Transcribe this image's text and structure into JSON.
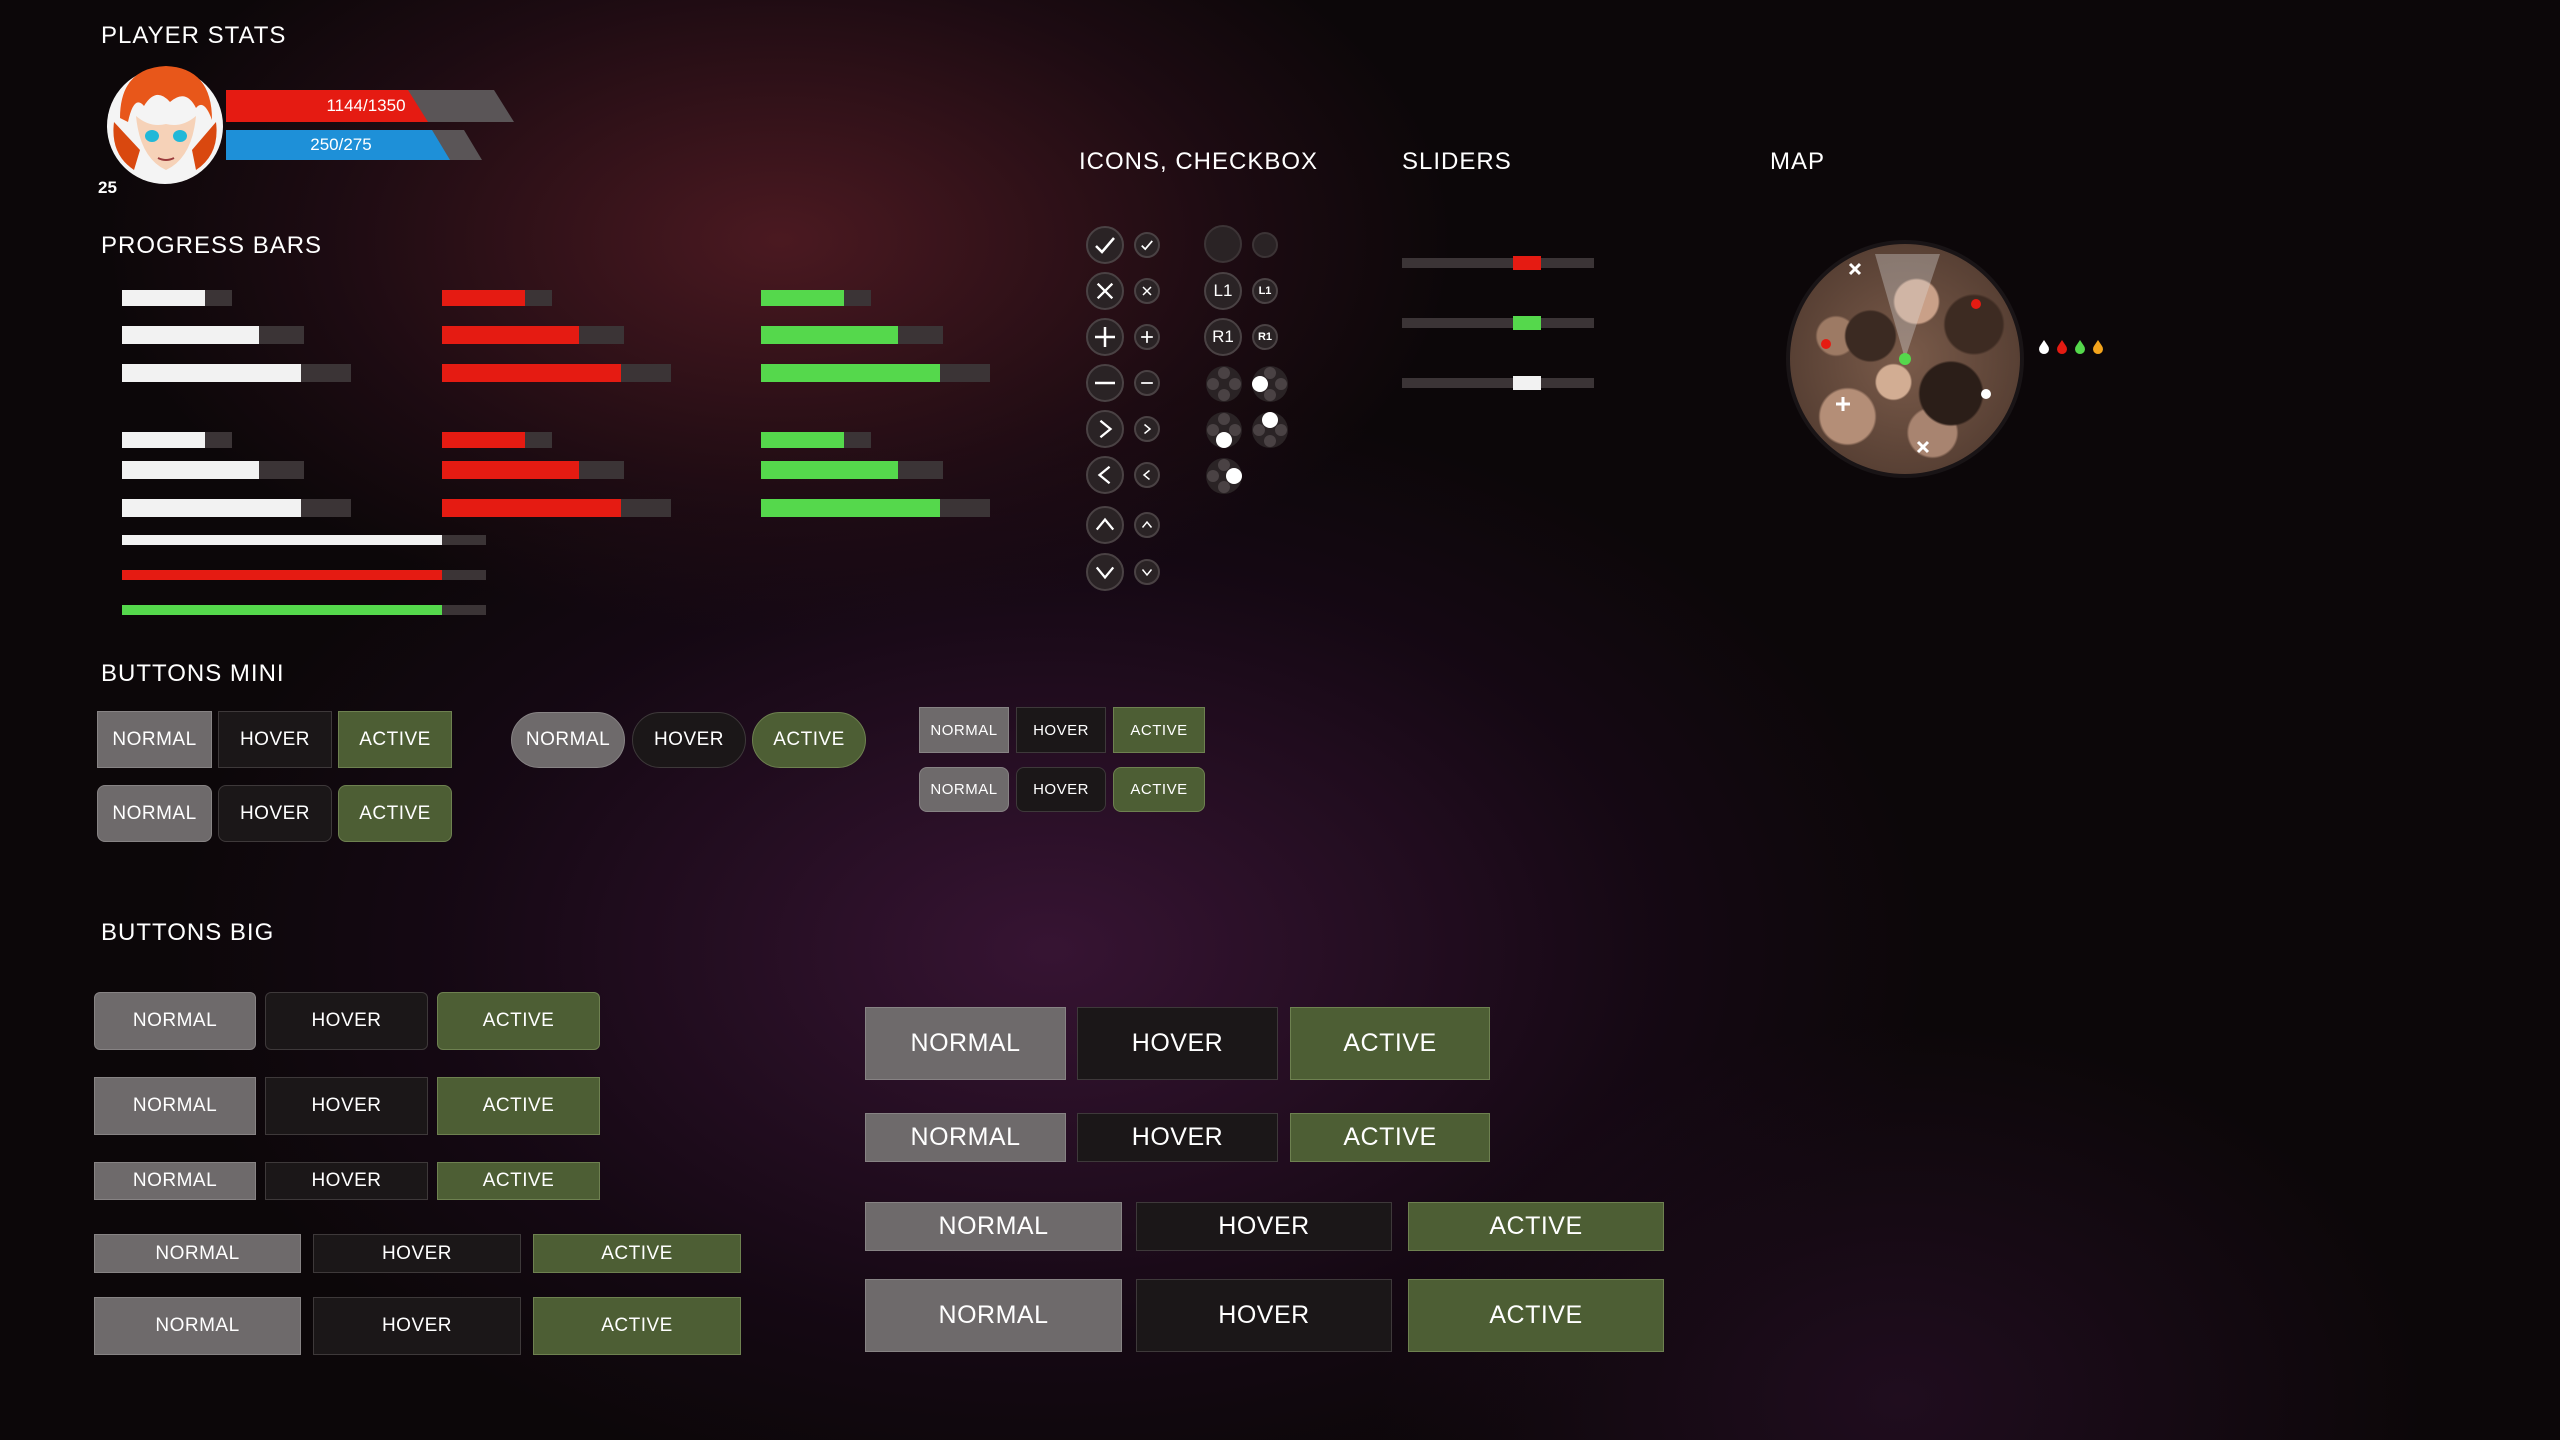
{
  "sections": {
    "player_stats": "PLAYER STATS",
    "progress_bars": "PROGRESS BARS",
    "icons_checkbox": "ICONS, CHECKBOX",
    "sliders": "SLIDERS",
    "map": "MAP",
    "buttons_mini": "BUTTONS MINI",
    "buttons_big": "BUTTONS BIG"
  },
  "player": {
    "health_text": "1144/1350",
    "health_fraction": 0.847,
    "mana_text": "250/275",
    "mana_fraction": 0.909,
    "level": "25"
  },
  "progress": {
    "groups_fill_fractions": [
      0.75,
      0.75,
      0.78
    ],
    "long_bar_fill_fraction": 0.88
  },
  "sliders": {
    "values": [
      0.65,
      0.65,
      0.65
    ],
    "colors": [
      "#e51b12",
      "#55d84c",
      "#f2f2f2"
    ]
  },
  "icons": {
    "controller_labels": [
      "L1",
      "R1"
    ],
    "glyphs": [
      "check-icon",
      "close-icon",
      "plus-icon",
      "minus-icon",
      "chevron-right-icon",
      "chevron-left-icon",
      "chevron-up-icon",
      "chevron-down-icon"
    ]
  },
  "buttons": {
    "normal": "NORMAL",
    "hover": "HOVER",
    "active": "ACTIVE"
  },
  "colors": {
    "red": "#e51b12",
    "green": "#55d84c",
    "blue": "#1e90d8",
    "active_button": "#4d5e34",
    "normal_button": "#6e6a6b",
    "hover_button": "#1b1718"
  }
}
